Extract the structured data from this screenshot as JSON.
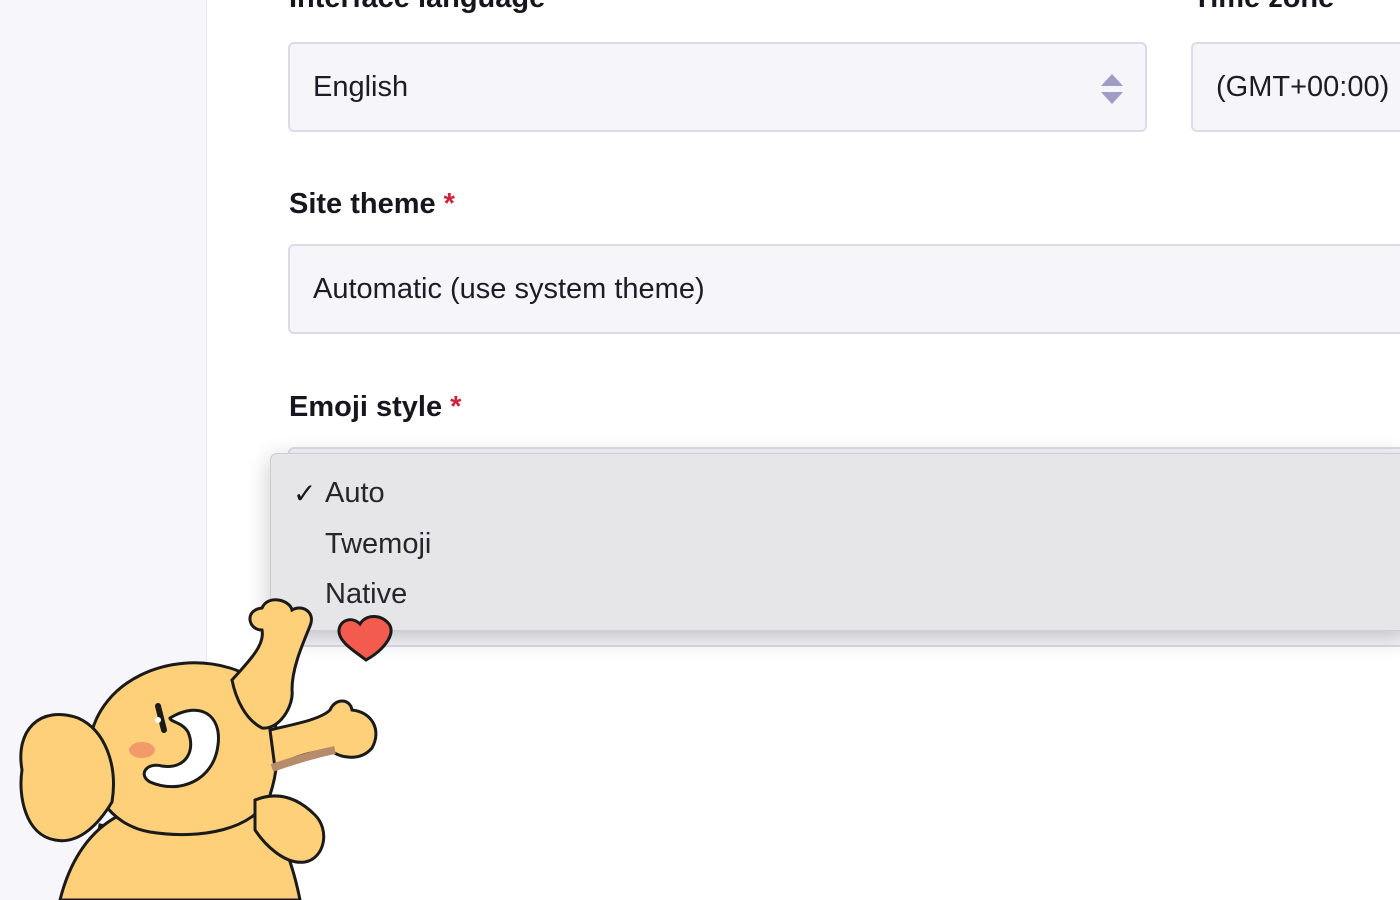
{
  "form": {
    "interface_language": {
      "label": "Interface language",
      "value": "English"
    },
    "time_zone": {
      "label": "Time zone",
      "value": "(GMT+00:00)"
    },
    "site_theme": {
      "label": "Site theme",
      "required_mark": "*",
      "value": "Automatic (use system theme)"
    },
    "emoji_style": {
      "label": "Emoji style",
      "required_mark": "*",
      "checkmark": "✓",
      "options": [
        "Auto",
        "Twemoji",
        "Native"
      ],
      "selected": "Auto"
    }
  },
  "colors": {
    "required": "#d0233a",
    "mascot_body": "#ffd07a",
    "heart": "#f35b4f"
  },
  "icons": {
    "select_arrows": "up-down-chevron-icon",
    "check": "checkmark-icon",
    "mascot": "mastodon-mascot-icon",
    "heart": "heart-icon"
  }
}
